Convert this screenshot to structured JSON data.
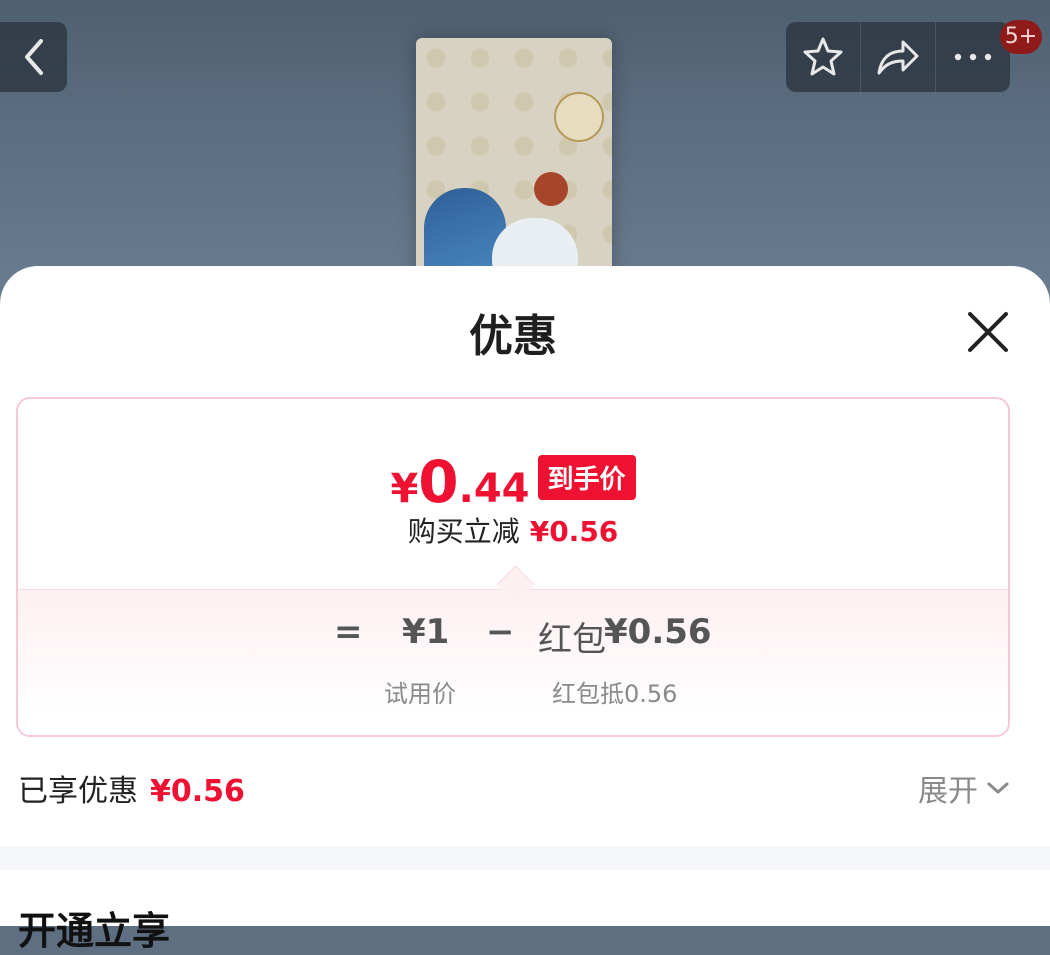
{
  "top_bar": {
    "back_icon": "chevron-left-icon",
    "actions": [
      "star-icon",
      "share-icon",
      "more-icon"
    ],
    "badge_label": "5+"
  },
  "sheet": {
    "title": "优惠",
    "close_icon": "close-icon"
  },
  "price_card": {
    "currency": "¥",
    "price_integer": "0",
    "price_decimals": ".44",
    "final_price_tag": "到手价",
    "save_label": "购买立减",
    "save_amount": "¥0.56",
    "formula": {
      "equals": "=",
      "base_value": "¥1",
      "minus": "−",
      "discount_name": "红包",
      "discount_value": "¥0.56",
      "base_label": "试用价",
      "discount_label": "红包抵0.56"
    }
  },
  "summary": {
    "enjoyed_label": "已享优惠",
    "enjoyed_amount": "¥0.56",
    "expand_label": "展开"
  },
  "next_section": {
    "title_partial": "开通立享"
  },
  "colors": {
    "accent_red": "#ee1131",
    "card_border": "#f6c9d3"
  }
}
